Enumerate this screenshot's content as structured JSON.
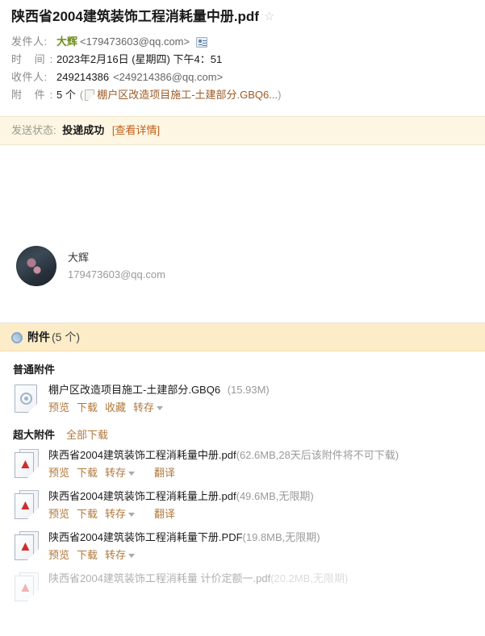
{
  "header": {
    "subject": "陕西省2004建筑装饰工程消耗量中册.pdf",
    "star_icon": "star-outline-icon",
    "rows": {
      "from_label": "发件人:",
      "from_name": "大辉",
      "from_address": "<179473603@qq.com>",
      "contact_icon": "contact-card-icon",
      "time_label": "时 间:",
      "time_value": "2023年2月16日 (星期四) 下午4：51",
      "to_label": "收件人:",
      "to_name": "249214386",
      "to_address": "<249214386@qq.com>",
      "att_label": "附 件:",
      "att_count": "5 个",
      "att_open_paren": "(",
      "att_first_name": "棚户区改造项目施工-土建部分.GBQ6...",
      "att_close_paren": ")",
      "att_inline_icon": "file-icon"
    }
  },
  "status": {
    "label": "发送状态:",
    "value": "投递成功",
    "detail_link": "[查看详情]"
  },
  "signature": {
    "avatar": "user-avatar",
    "name": "大辉",
    "email": "179473603@qq.com"
  },
  "attachments": {
    "panel_icon": "paperclip-icon",
    "panel_title": "附件",
    "panel_count": "(5 个)",
    "normal": {
      "section_title": "普通附件",
      "items": [
        {
          "icon": "generic-file-icon",
          "filename": "棚户区改造项目施工-土建部分.GBQ6",
          "size": "(15.93M)",
          "actions": [
            "预览",
            "下载",
            "收藏",
            "转存"
          ],
          "has_caret": true,
          "translate": null
        }
      ]
    },
    "large": {
      "section_title": "超大附件",
      "download_all": "全部下载",
      "items": [
        {
          "icon": "pdf-file-icon",
          "filename": "陕西省2004建筑装饰工程消耗量中册.pdf",
          "size": "(62.6MB,28天后该附件将不可下载)",
          "actions": [
            "预览",
            "下载",
            "转存"
          ],
          "has_caret": true,
          "translate": "翻译"
        },
        {
          "icon": "pdf-file-icon",
          "filename": "陕西省2004建筑装饰工程消耗量上册.pdf",
          "size": "(49.6MB,无限期)",
          "actions": [
            "预览",
            "下载",
            "转存"
          ],
          "has_caret": true,
          "translate": "翻译"
        },
        {
          "icon": "pdf-file-icon",
          "filename": "陕西省2004建筑装饰工程消耗量下册.PDF",
          "size": "(19.8MB,无限期)",
          "actions": [
            "预览",
            "下载",
            "转存"
          ],
          "has_caret": true,
          "translate": null
        },
        {
          "icon": "pdf-file-icon",
          "filename": "陕西省2004建筑装饰工程消耗量 计价定额一.pdf",
          "size": "(20.2MB,无限期)",
          "actions": [],
          "has_caret": false,
          "translate": null
        }
      ]
    }
  },
  "colors": {
    "accent_link": "#b1783b",
    "status_bg": "#fdf6e3",
    "attachment_header_bg": "#fdecc8",
    "sender_name": "#6f8b1c",
    "muted": "#9a9a9a"
  }
}
